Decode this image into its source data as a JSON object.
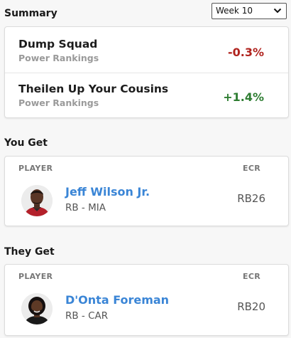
{
  "summary": {
    "title": "Summary",
    "week_select": "Week 10",
    "teams": [
      {
        "name": "Dump Squad",
        "subtitle": "Power Rankings",
        "change": "-0.3%",
        "trend": "negative"
      },
      {
        "name": "Theilen Up Your Cousins",
        "subtitle": "Power Rankings",
        "change": "+1.4%",
        "trend": "positive"
      }
    ]
  },
  "you_get": {
    "title": "You Get",
    "col_player": "PLAYER",
    "col_ecr": "ECR",
    "player": {
      "name": "Jeff Wilson Jr.",
      "position": "RB - MIA",
      "ecr": "RB26"
    }
  },
  "they_get": {
    "title": "They Get",
    "col_player": "PLAYER",
    "col_ecr": "ECR",
    "player": {
      "name": "D'Onta Foreman",
      "position": "RB - CAR",
      "ecr": "RB20"
    }
  },
  "colors": {
    "link_blue": "#3a85d6",
    "negative_red": "#b0231e",
    "positive_green": "#2e7d32"
  },
  "icons": {
    "week_dropdown": "chevron-down-icon"
  }
}
